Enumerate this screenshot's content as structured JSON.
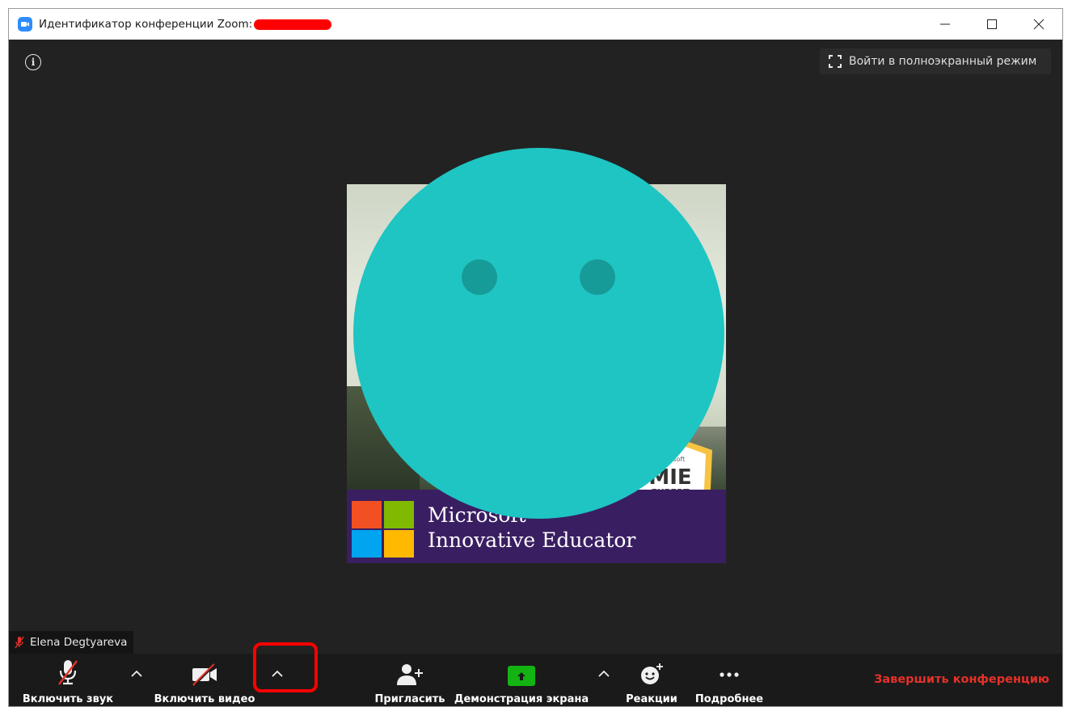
{
  "window": {
    "title": "Идентификатор конференции Zoom:"
  },
  "meeting": {
    "fullscreen_label": "Войти в полноэкранный режим",
    "participant_name": "Elena Degtyareva",
    "banner": {
      "line1": "Microsoft",
      "line2": "Innovative Educator",
      "badge_top": "Microsoft",
      "badge_main": "MIE",
      "badge_sub": "EXPERT"
    }
  },
  "toolbar": {
    "audio_label": "Включить звук",
    "video_label": "Включить видео",
    "invite_label": "Пригласить",
    "share_label": "Демонстрация экрана",
    "reactions_label": "Реакции",
    "more_label": "Подробнее",
    "end_label": "Завершить конференцию"
  },
  "colors": {
    "end_red": "#e5312a",
    "share_green": "#12b312",
    "avatar": "#1ec5c3",
    "highlight": "#ff0000"
  }
}
